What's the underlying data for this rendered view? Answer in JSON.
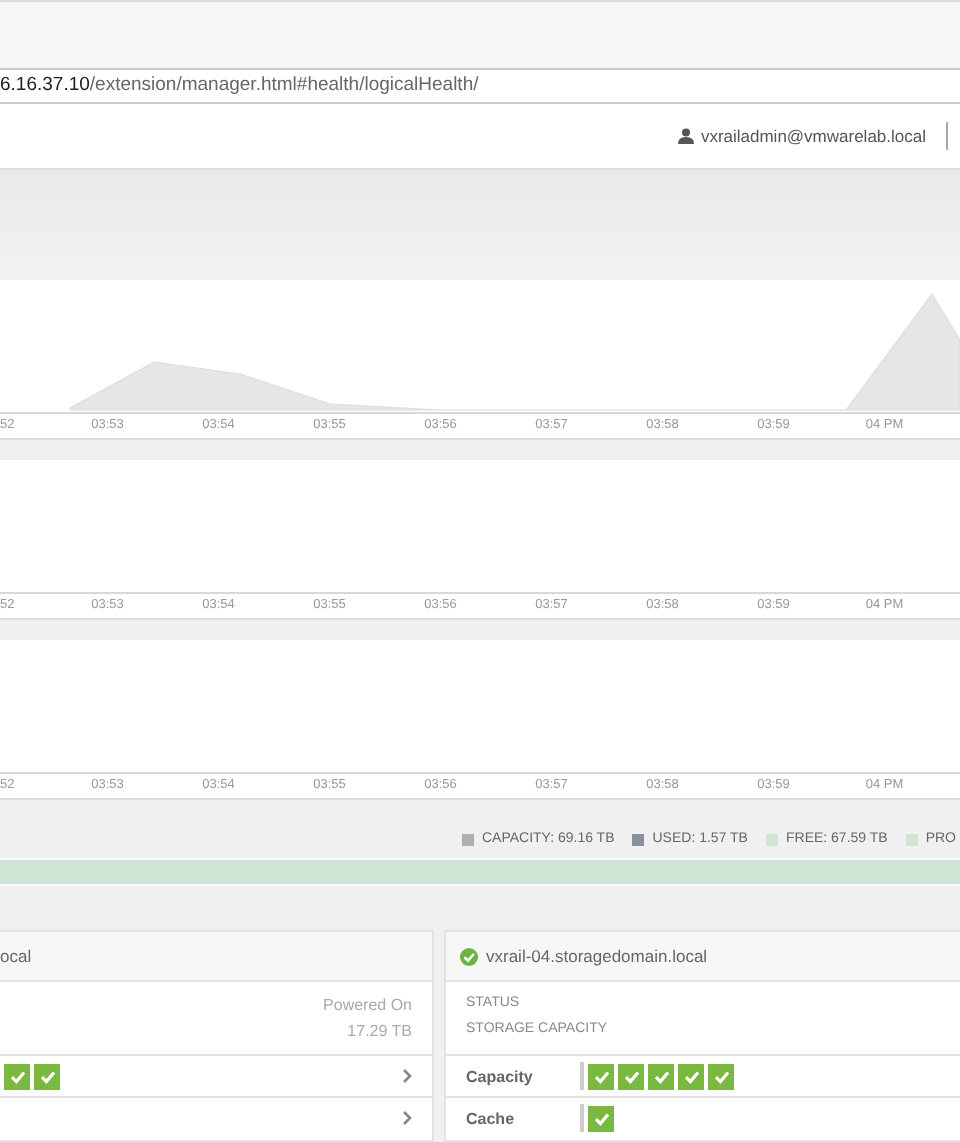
{
  "browser": {
    "url_host": "6.16.37.10",
    "url_path": "/extension/manager.html#health/logicalHealth/"
  },
  "header": {
    "user": "vxrailadmin@vmwarelab.local"
  },
  "charts": [
    {
      "time_labels": [
        "52",
        "03:53",
        "03:54",
        "03:55",
        "03:56",
        "03:57",
        "03:58",
        "03:59",
        "04 PM"
      ]
    },
    {
      "time_labels": [
        "52",
        "03:53",
        "03:54",
        "03:55",
        "03:56",
        "03:57",
        "03:58",
        "03:59",
        "04 PM"
      ]
    },
    {
      "time_labels": [
        "52",
        "03:53",
        "03:54",
        "03:55",
        "03:56",
        "03:57",
        "03:58",
        "03:59",
        "04 PM"
      ]
    }
  ],
  "legend": [
    {
      "label": "CAPACITY: 69.16 TB",
      "color": "#b0b0b0"
    },
    {
      "label": "USED: 1.57 TB",
      "color": "#8a909a"
    },
    {
      "label": "FREE: 67.59 TB",
      "color": "#cfe6d6"
    },
    {
      "label": "PRO",
      "color": "#cfe6d6"
    }
  ],
  "hosts": [
    {
      "name": "ocal",
      "status_value": "Powered On",
      "capacity_value": "17.29 TB",
      "chevrons": true,
      "rows": [
        {
          "disks": [
            {
              "ok": true
            },
            {
              "ok": true
            }
          ]
        },
        {
          "disks": []
        }
      ]
    },
    {
      "name": "vxrail-04.storagedomain.local",
      "healthy": true,
      "status_label": "STATUS",
      "capacity_label": "STORAGE CAPACITY",
      "chevrons": false,
      "rows": [
        {
          "label": "Capacity",
          "disks": [
            {
              "ok": true
            },
            {
              "ok": true
            },
            {
              "ok": true
            },
            {
              "ok": true
            },
            {
              "ok": true
            }
          ]
        },
        {
          "label": "Cache",
          "disks": [
            {
              "ok": true
            }
          ]
        }
      ]
    }
  ]
}
